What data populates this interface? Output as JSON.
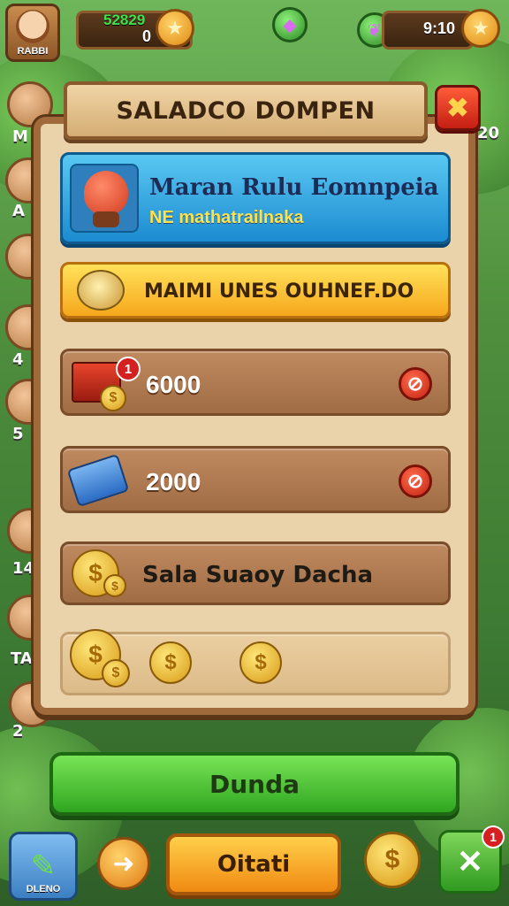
{
  "topbar": {
    "profile_name": "RABBI",
    "currency_primary": "52829",
    "currency_primary_sub": "0",
    "currency_secondary": "9:10"
  },
  "side_numbers": [
    "M",
    "A",
    "4",
    "5",
    "14",
    "TA",
    "2",
    "20"
  ],
  "dialog": {
    "title": "SALADCO DOMPEN",
    "close_symbol": "✖",
    "featured": {
      "title": "Maran Rulu Eomnpeia",
      "subtitle": "NE mathatrailnaka"
    },
    "banner": {
      "text": "MAIMI UNES OUHNEF.DO"
    },
    "items": [
      {
        "value": "6000",
        "badge": "1"
      },
      {
        "value": "2000"
      },
      {
        "value": "Sala Suaoy Dacha"
      },
      {
        "value": ""
      }
    ]
  },
  "buttons": {
    "primary": "Dunda",
    "secondary": "Oitati",
    "pencil_label": "DLENO",
    "x_badge": "1"
  },
  "icons": {
    "star": "★",
    "coin": "$",
    "arrow": "➜",
    "close": "✕",
    "no": "⊘"
  }
}
